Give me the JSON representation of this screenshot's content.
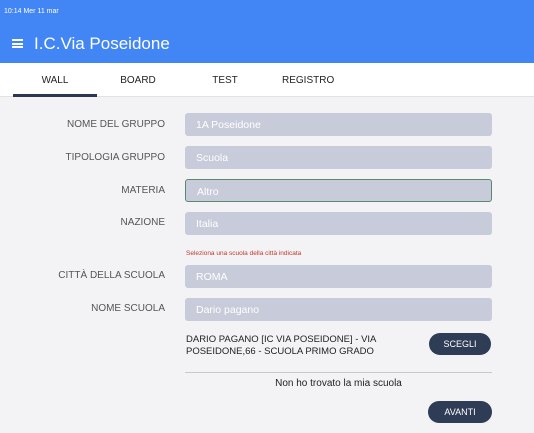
{
  "status_bar": {
    "time_date": "10:14  Mer 11 mar"
  },
  "header": {
    "title": "I.C.Via Poseidone"
  },
  "tabs": [
    {
      "label": "WALL"
    },
    {
      "label": "BOARD"
    },
    {
      "label": "TEST"
    },
    {
      "label": "REGISTRO"
    }
  ],
  "form": {
    "group_name": {
      "label": "NOME DEL GRUPPO",
      "value": "1A Poseidone"
    },
    "group_type": {
      "label": "TIPOLOGIA GRUPPO",
      "value": "Scuola"
    },
    "subject": {
      "label": "MATERIA",
      "value": "Altro"
    },
    "country": {
      "label": "NAZIONE",
      "value": "Italia"
    },
    "hint": "Seleziona una scuola della città indicata",
    "school_city": {
      "label": "CITTÀ DELLA SCUOLA",
      "value": "ROMA"
    },
    "school_name": {
      "label": "NOME SCUOLA",
      "value": "Dario pagano"
    }
  },
  "result": {
    "text": "DARIO PAGANO [IC VIA POSEIDONE] - VIA POSEIDONE,66 - SCUOLA PRIMO GRADO",
    "choose_label": "SCEGLI"
  },
  "not_found": "Non ho trovato la mia scuola",
  "next_label": "AVANTI",
  "colors": {
    "header": "#4285f4",
    "field": "#c8cbd9",
    "button": "#2f3c56",
    "hint": "#c0392b"
  }
}
